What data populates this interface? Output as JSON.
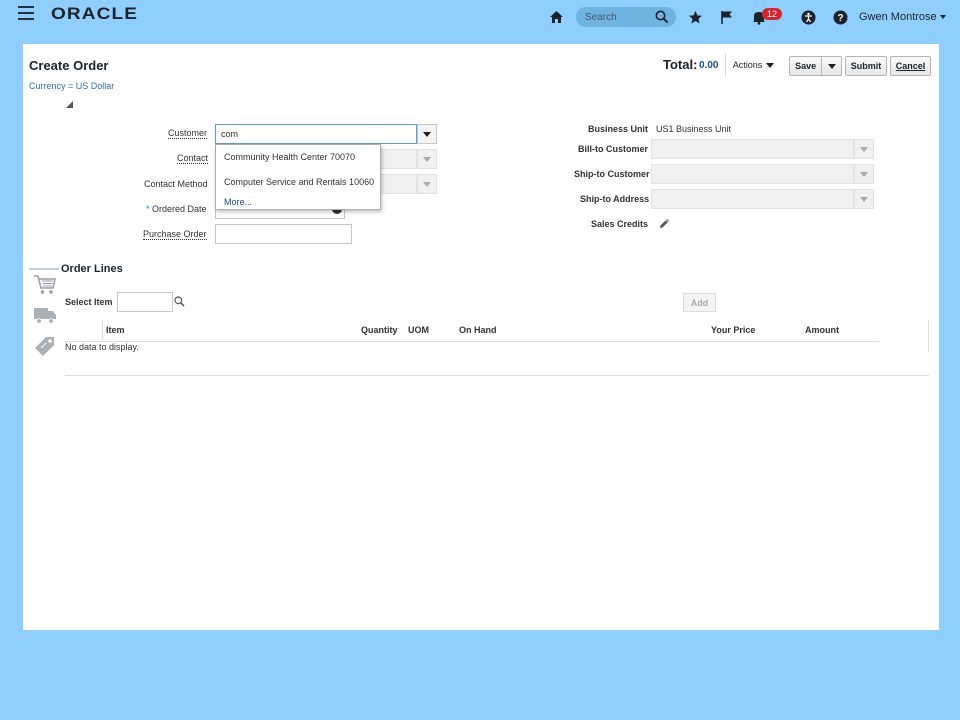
{
  "header": {
    "brand": "ORACLE",
    "search_placeholder": "Search",
    "notification_count": "12",
    "user_name": "Gwen Montrose"
  },
  "page": {
    "title": "Create Order",
    "currency": "Currency = US Dollar",
    "total_label": "Total:",
    "total_value": "0.00",
    "actions_label": "Actions",
    "save_label": "Save",
    "submit_label": "Submit",
    "cancel_label": "Cancel"
  },
  "form_left": {
    "customer_label": "Customer",
    "customer_value": "com",
    "contact_label": "Contact",
    "contact_method_label": "Contact Method",
    "ordered_date_label": "Ordered Date",
    "required_marker": "*",
    "purchase_order_label": "Purchase Order"
  },
  "customer_suggestions": {
    "items": [
      "Community Health Center 70070",
      "Computer Service and Rentals 10060"
    ],
    "more_label": "More..."
  },
  "form_right": {
    "business_unit_label": "Business Unit",
    "business_unit_value": "US1 Business Unit",
    "bill_to_customer_label": "Bill-to Customer",
    "ship_to_customer_label": "Ship-to Customer",
    "ship_to_address_label": "Ship-to Address",
    "sales_credits_label": "Sales Credits"
  },
  "order_lines": {
    "title": "Order Lines",
    "select_item_label": "Select Item",
    "add_label": "Add",
    "columns": {
      "item": "Item",
      "quantity": "Quantity",
      "uom": "UOM",
      "on_hand": "On Hand",
      "your_price": "Your Price",
      "amount": "Amount"
    },
    "empty_text": "No data to display."
  },
  "colors": {
    "background": "#8ecfff",
    "link": "#2b74b8",
    "badge": "#d8232a"
  }
}
